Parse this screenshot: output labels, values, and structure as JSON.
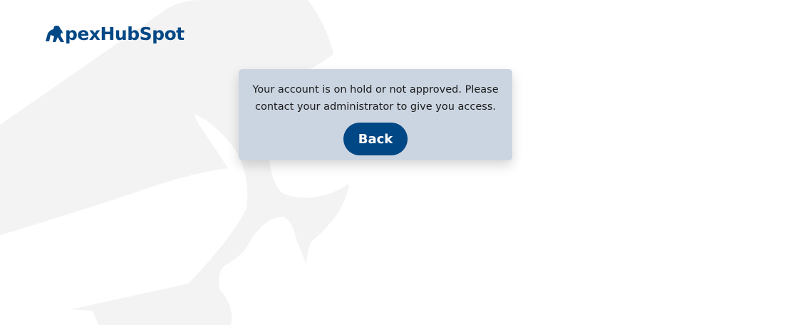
{
  "brand": {
    "logo_icon": "gorilla-logo-icon",
    "name": "pexHubSpot",
    "color": "#004785"
  },
  "dialog": {
    "message": "Your account is on hold or not approved. Please contact your administrator to give you access.",
    "back_label": "Back",
    "background": "#cbd5e1"
  },
  "background": {
    "art_icon": "gorilla-watermark-icon",
    "art_color": "#f3f3f3"
  }
}
